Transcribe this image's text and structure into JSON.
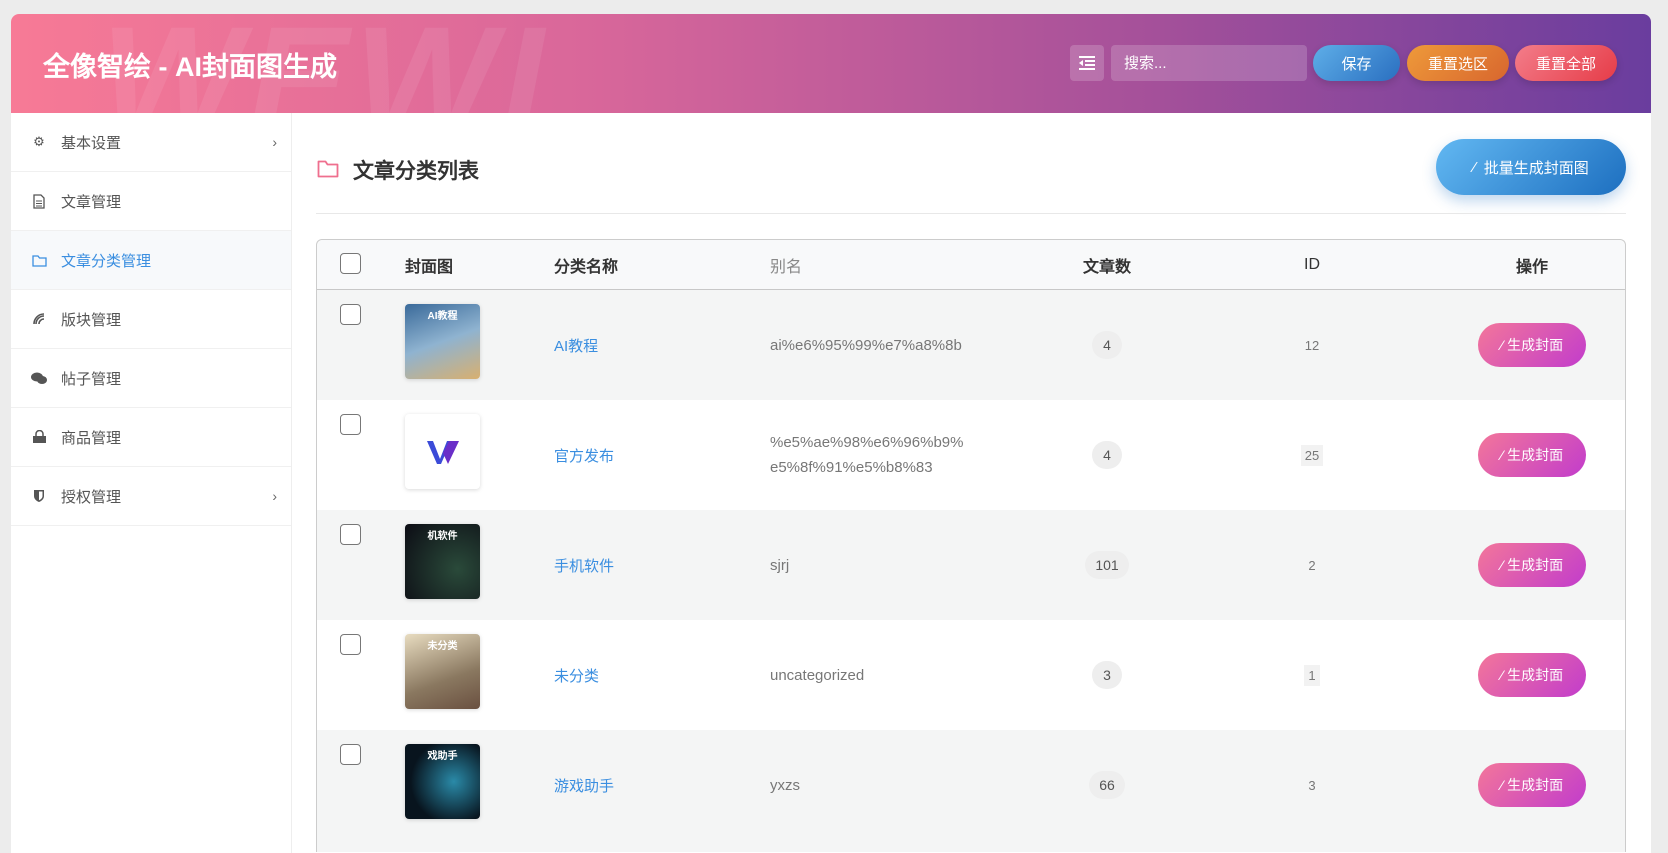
{
  "header": {
    "title": "全像智绘 - AI封面图生成",
    "watermark": "WEWL",
    "search_placeholder": "搜索...",
    "save": "保存",
    "reset_selection": "重置选区",
    "reset_all": "重置全部"
  },
  "sidebar": {
    "items": [
      {
        "label": "基本设置",
        "icon": "gear-icon",
        "has_submenu": true
      },
      {
        "label": "文章管理",
        "icon": "document-icon"
      },
      {
        "label": "文章分类管理",
        "icon": "folder-icon",
        "active": true
      },
      {
        "label": "版块管理",
        "icon": "signal-icon"
      },
      {
        "label": "帖子管理",
        "icon": "comments-icon"
      },
      {
        "label": "商品管理",
        "icon": "shopping-bag-icon"
      },
      {
        "label": "授权管理",
        "icon": "shield-icon",
        "has_submenu": true
      }
    ]
  },
  "main": {
    "title": "文章分类列表",
    "batch_button": "批量生成封面图",
    "columns": {
      "cover": "封面图",
      "name": "分类名称",
      "alias": "别名",
      "count": "文章数",
      "id": "ID",
      "action": "操作"
    },
    "action_label": "生成封面",
    "rows": [
      {
        "thumb_text": "AI教程",
        "name": "AI教程",
        "alias": "ai%e6%95%99%e7%a8%8b",
        "count": "4",
        "id": "12"
      },
      {
        "thumb_text": "",
        "name": "官方发布",
        "alias": "%e5%ae%98%e6%96%b9%e5%8f%91%e5%b8%83",
        "count": "4",
        "id": "25"
      },
      {
        "thumb_text": "机软件",
        "name": "手机软件",
        "alias": "sjrj",
        "count": "101",
        "id": "2"
      },
      {
        "thumb_text": "未分类",
        "name": "未分类",
        "alias": "uncategorized",
        "count": "3",
        "id": "1"
      },
      {
        "thumb_text": "戏助手",
        "name": "游戏助手",
        "alias": "yxzs",
        "count": "66",
        "id": "3"
      }
    ]
  },
  "colors": {
    "accent": "#3a8ee0",
    "header_start": "#f77a96",
    "header_end": "#6a3d9e"
  }
}
